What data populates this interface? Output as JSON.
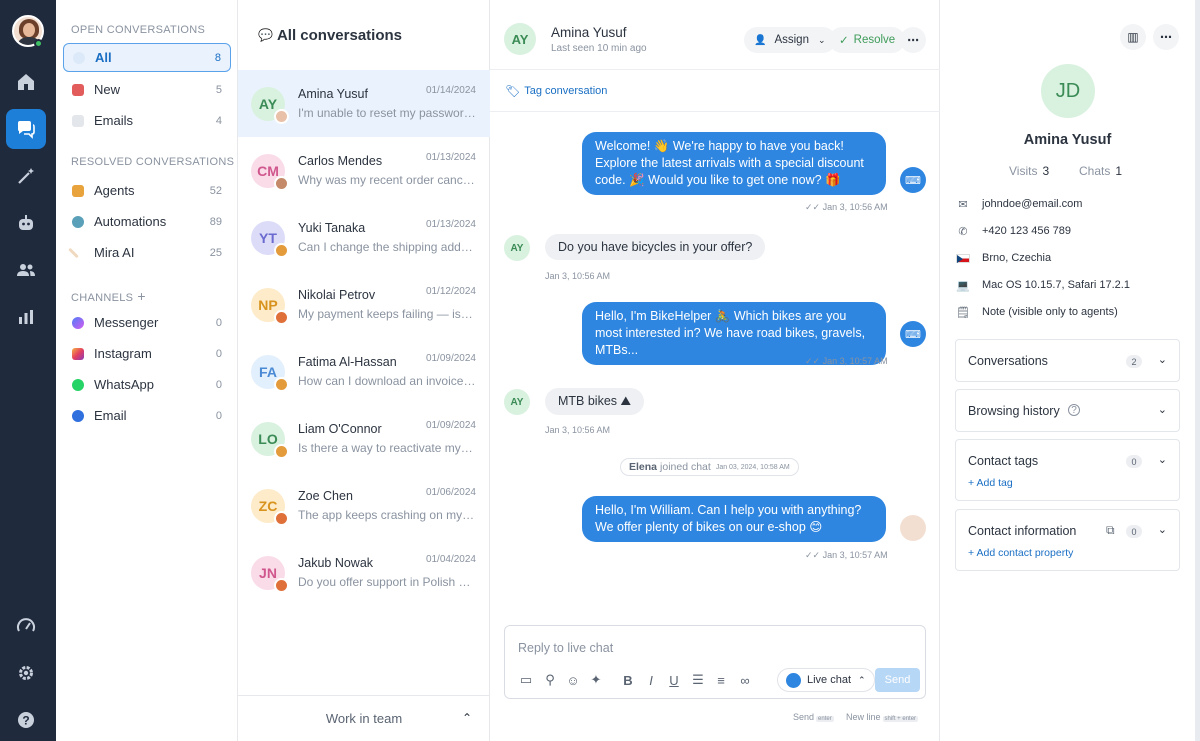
{
  "folders": {
    "open_title": "OPEN CONVERSATIONS",
    "open": [
      {
        "label": "All",
        "count": "8"
      },
      {
        "label": "New",
        "count": "5"
      },
      {
        "label": "Emails",
        "count": "4"
      }
    ],
    "resolved_title": "RESOLVED CONVERSATIONS",
    "resolved": [
      {
        "label": "Agents",
        "count": "52"
      },
      {
        "label": "Automations",
        "count": "89"
      },
      {
        "label": "Mira AI",
        "count": "25"
      }
    ],
    "channels_title": "CHANNELS",
    "channels": [
      {
        "label": "Messenger",
        "count": "0"
      },
      {
        "label": "Instagram",
        "count": "0"
      },
      {
        "label": "WhatsApp",
        "count": "0"
      },
      {
        "label": "Email",
        "count": "0"
      }
    ]
  },
  "list": {
    "title": "All conversations",
    "items": [
      {
        "initials": "AY",
        "name": "Amina Yusuf",
        "date": "01/14/2024",
        "preview": "I'm unable to reset my password. I've tried"
      },
      {
        "initials": "CM",
        "name": "Carlos Mendes",
        "date": "01/13/2024",
        "preview": "Why was my recent order canceled without"
      },
      {
        "initials": "YT",
        "name": "Yuki Tanaka",
        "date": "01/13/2024",
        "preview": "Can I change the shipping address after"
      },
      {
        "initials": "NP",
        "name": "Nikolai Petrov",
        "date": "01/12/2024",
        "preview": "My payment keeps failing — is there an issue"
      },
      {
        "initials": "FA",
        "name": "Fatima Al-Hassan",
        "date": "01/09/2024",
        "preview": "How can I download an invoice for my order"
      },
      {
        "initials": "LO",
        "name": "Liam O'Connor",
        "date": "01/09/2024",
        "preview": "Is there a way to reactivate my deleted account"
      },
      {
        "initials": "ZC",
        "name": "Zoe Chen",
        "date": "01/06/2024",
        "preview": "The app keeps crashing on my phone whenever"
      },
      {
        "initials": "JN",
        "name": "Jakub Nowak",
        "date": "01/04/2024",
        "preview": "Do you offer support in Polish or other languages"
      }
    ],
    "team_label": "Work in team"
  },
  "chat": {
    "initials": "AY",
    "name": "Amina Yusuf",
    "last_seen": "Last seen 10 min ago",
    "assign": "Assign",
    "resolve": "Resolve",
    "tag": "Tag conversation",
    "messages": [
      {
        "text": "Welcome! 👋 We're happy to have you back! Explore the latest arrivals with a special discount code. 🎉 Would you like to get one now? 🎁",
        "time": "Jan 3, 10:56 AM"
      },
      {
        "text": "Do you have bicycles in your offer?",
        "time": "Jan 3, 10:56 AM"
      },
      {
        "text": "Hello, I'm BikeHelper 🚴 Which bikes are you most interested in? We have road bikes, gravels, MTBs...",
        "time": "Jan 3, 10:57 AM"
      },
      {
        "text": "MTB bikes ⛰",
        "time": "Jan 3, 10:56 AM"
      },
      {
        "text": "Hello, I'm William. Can I help you with anything? We offer plenty of bikes on our e-shop 😊",
        "time": "Jan 3, 10:57 AM"
      }
    ],
    "system": {
      "who": "Elena",
      "text": "joined chat",
      "time": "Jan 03, 2024, 10:58 AM"
    },
    "composer_placeholder": "Reply to live chat",
    "channel": "Live chat",
    "send": "Send",
    "hint_send": "Send",
    "hint_send_key": "enter",
    "hint_newline": "New line",
    "hint_newline_key": "shift + enter"
  },
  "contact": {
    "initials": "JD",
    "name": "Amina Yusuf",
    "visits_label": "Visits",
    "visits": "3",
    "chats_label": "Chats",
    "chats": "1",
    "email": "johndoe@email.com",
    "phone": "+420 123 456 789",
    "location": "Brno, Czechia",
    "device": "Mac OS 10.15.7, Safari 17.2.1",
    "note": "Note (visible only to agents)",
    "conversations": "Conversations",
    "conversations_count": "2",
    "browsing": "Browsing history",
    "tags": "Contact tags",
    "tags_count": "0",
    "add_tag": "+ Add tag",
    "contact_info": "Contact information",
    "contact_info_count": "0",
    "add_property": "+ Add contact property"
  },
  "colors": {
    "accent": "#2f86e0",
    "rail": "#1f2a3d",
    "online": "#3fbf63"
  }
}
